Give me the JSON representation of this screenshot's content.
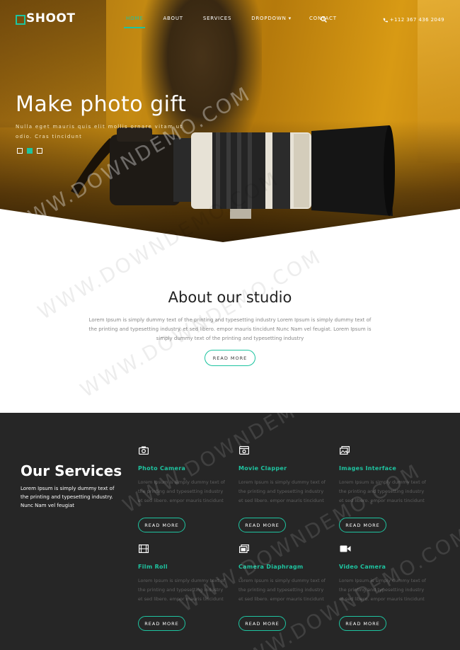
{
  "brand": {
    "logo_text": "SHOOT",
    "accent": "#1ec4a0",
    "dark_bg": "#262626"
  },
  "nav": {
    "items": [
      {
        "label": "HOME",
        "active": true
      },
      {
        "label": "ABOUT"
      },
      {
        "label": "SERVICES"
      },
      {
        "label": "DROPDOWN ▾"
      },
      {
        "label": "CONTACT"
      }
    ],
    "search_icon": "search-icon",
    "phone": "+112 367 436 2049"
  },
  "hero": {
    "title": "Make photo gift",
    "subtitle": "Nulla eget mauris quis elit mollis ornare vitam ut odio. Cras tincidunt",
    "slides": [
      {
        "active": false
      },
      {
        "active": true
      },
      {
        "active": false
      }
    ]
  },
  "about": {
    "title": "About our studio",
    "text": "Lorem Ipsum is simply dummy text of the printing and typesetting industry Lorem Ipsum is simply dummy text of the printing and typesetting industry. et sed libero. empor mauris tincidunt Nunc Nam vel feugiat. Lorem Ipsum is simply dummy text of the printing and typesetting industry",
    "button": "READ MORE"
  },
  "services": {
    "title": "Our Services",
    "text": "Lorem Ipsum is simply dummy text of the printing and typesetting industry. Nunc Nam vel feugiat",
    "items": [
      {
        "name": "Photo Camera",
        "icon": "camera-icon",
        "desc": "Lorem Ipsum is simply dummy text of the printing and typesetting industry et sed libero. empor mauris tincidunt",
        "button": "READ MORE"
      },
      {
        "name": "Movie Clapper",
        "icon": "clapper-icon",
        "desc": "Lorem Ipsum is simply dummy text of the printing and typesetting industry et sed libero. empor mauris tincidunt",
        "button": "READ MORE"
      },
      {
        "name": "Images Interface",
        "icon": "images-icon",
        "desc": "Lorem Ipsum is simply dummy text of the printing and typesetting industry et sed libero. empor mauris tincidunt",
        "button": "READ MORE"
      },
      {
        "name": "Film Roll",
        "icon": "film-icon",
        "desc": "Lorem Ipsum is simply dummy text of the printing and typesetting industry et sed libero. empor mauris tincidunt",
        "button": "READ MORE"
      },
      {
        "name": "Camera Diaphragm",
        "icon": "diaphragm-icon",
        "desc": "Lorem Ipsum is simply dummy text of the printing and typesetting industry et sed libero. empor mauris tincidunt",
        "button": "READ MORE"
      },
      {
        "name": "Video Camera",
        "icon": "video-camera-icon",
        "desc": "Lorem Ipsum is simply dummy text of the printing and typesetting industry et sed libero. empor mauris tincidunt",
        "button": "READ MORE"
      }
    ]
  },
  "watermark": "WWW.DOWNDEMO.COM"
}
